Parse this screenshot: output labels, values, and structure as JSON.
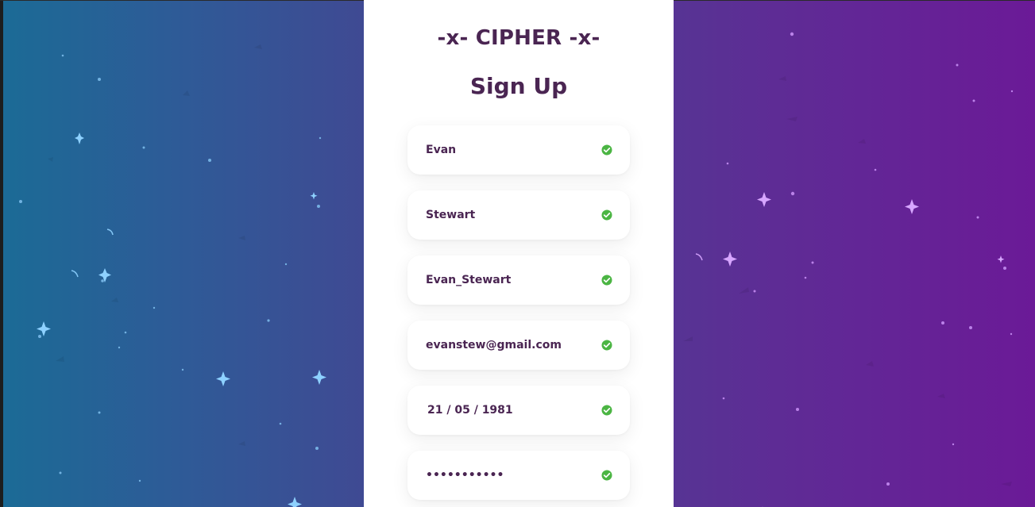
{
  "app": {
    "brand_title": "-x- CIPHER -x-",
    "form_title": "Sign Up"
  },
  "fields": [
    {
      "name": "first-name",
      "value": "Evan",
      "status_icon": "check-circle-icon"
    },
    {
      "name": "last-name",
      "value": "Stewart",
      "status_icon": "check-circle-icon"
    },
    {
      "name": "username",
      "value": "Evan_Stewart",
      "status_icon": "check-circle-icon"
    },
    {
      "name": "email",
      "value": "evanstew@gmail.com",
      "status_icon": "check-circle-icon"
    },
    {
      "name": "date-of-birth",
      "value": "21 / 05 / 1981",
      "status_icon": "check-circle-icon"
    },
    {
      "name": "password",
      "value": "•••••••••••",
      "status_icon": "check-circle-icon"
    }
  ],
  "colors": {
    "text_primary": "#4a2552",
    "panel_bg": "#ffffff",
    "valid_green": "#4bb543",
    "bg_gradient_start": "#1b6b96",
    "bg_gradient_end": "#6b1a97"
  }
}
